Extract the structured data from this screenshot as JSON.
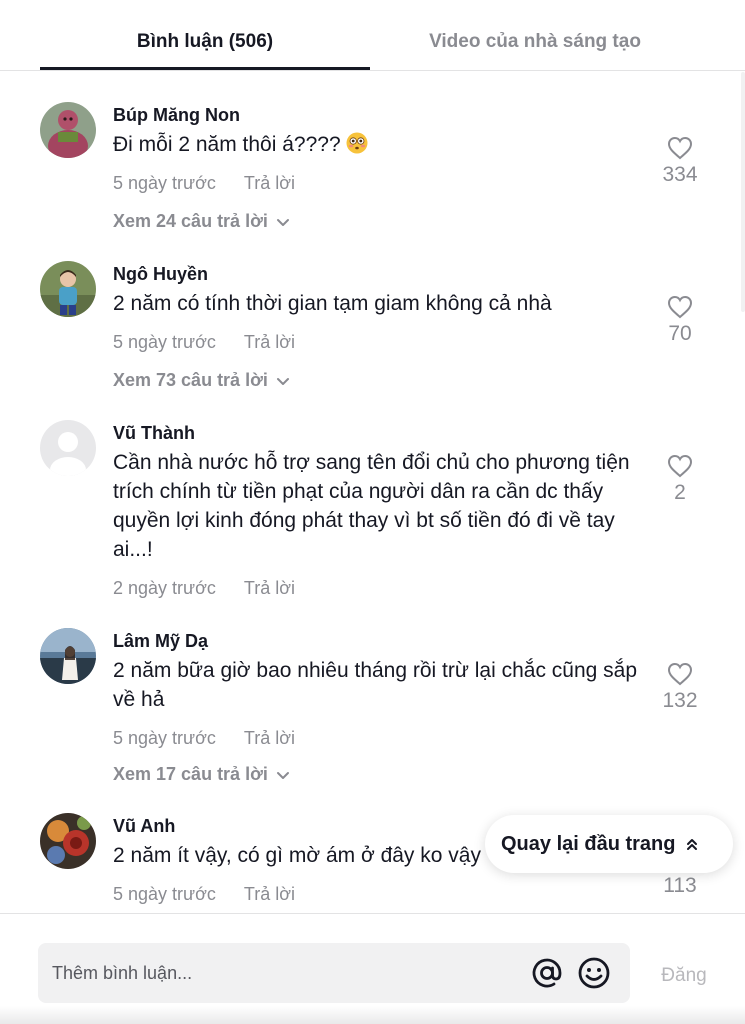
{
  "tabs": {
    "comments": "Bình luận (506)",
    "creator_videos": "Video của nhà sáng tạo"
  },
  "comments": [
    {
      "author": "Búp Măng Non",
      "text": "Đi mỗi 2 năm thôi á????",
      "emoji": "flushed-face",
      "time": "5 ngày trước",
      "reply": "Trả lời",
      "view_replies": "Xem 24 câu trả lời",
      "likes": "334"
    },
    {
      "author": "Ngô Huyền",
      "text": "2 năm có tính thời gian tạm giam không cả nhà",
      "time": "5 ngày trước",
      "reply": "Trả lời",
      "view_replies": "Xem 73 câu trả lời",
      "likes": "70"
    },
    {
      "author": "Vũ Thành",
      "text": "Cần nhà nước hỗ trợ sang tên đổi chủ cho phương tiện trích chính từ tiền phạt của người dân ra cần dc thấy quyền lợi kinh đóng phát thay vì bt số tiền đó đi về tay ai...!",
      "time": "2 ngày trước",
      "reply": "Trả lời",
      "likes": "2"
    },
    {
      "author": "Lâm Mỹ Dạ",
      "text": "2 năm bữa giờ bao nhiêu tháng rồi trừ lại chắc cũng sắp về hả",
      "time": "5 ngày trước",
      "reply": "Trả lời",
      "view_replies": "Xem 17 câu trả lời",
      "likes": "132"
    },
    {
      "author": "Vũ Anh",
      "text": "2 năm ít vậy, có gì mờ ám ở đây ko vậy",
      "time": "5 ngày trước",
      "reply": "Trả lời",
      "likes": "113"
    }
  ],
  "back_to_top": "Quay lại đầu trang",
  "composer": {
    "placeholder": "Thêm bình luận...",
    "post_label": "Đăng"
  },
  "colors": {
    "primary_text": "#161823",
    "secondary_text": "#8a8b91",
    "input_bg": "#f1f1f2",
    "disabled": "#b8b8bc"
  },
  "icons": [
    "heart-outline-icon",
    "chevron-down-icon",
    "double-chevron-up-icon",
    "mention-at-icon",
    "emoji-smile-icon",
    "default-avatar-icon"
  ]
}
